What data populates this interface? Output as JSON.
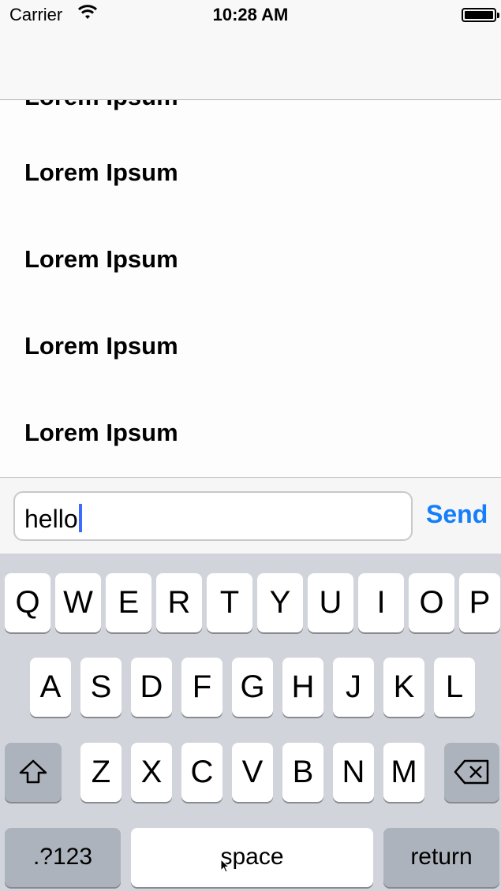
{
  "status_bar": {
    "carrier": "Carrier",
    "time": "10:28 AM"
  },
  "list": {
    "items": [
      "Lorem Ipsum",
      "Lorem Ipsum",
      "Lorem Ipsum",
      "Lorem Ipsum"
    ]
  },
  "composer": {
    "text_value": "hello",
    "send_label": "Send"
  },
  "keyboard": {
    "row1": [
      "Q",
      "W",
      "E",
      "R",
      "T",
      "Y",
      "U",
      "I",
      "O",
      "P"
    ],
    "row2": [
      "A",
      "S",
      "D",
      "F",
      "G",
      "H",
      "J",
      "K",
      "L"
    ],
    "row3": [
      "Z",
      "X",
      "C",
      "V",
      "B",
      "N",
      "M"
    ],
    "numbers_label": ".?123",
    "space_label": "space",
    "return_label": "return"
  },
  "icons": {
    "wifi": "wifi-icon",
    "battery": "battery-icon",
    "shift": "shift-icon",
    "delete": "delete-icon"
  }
}
